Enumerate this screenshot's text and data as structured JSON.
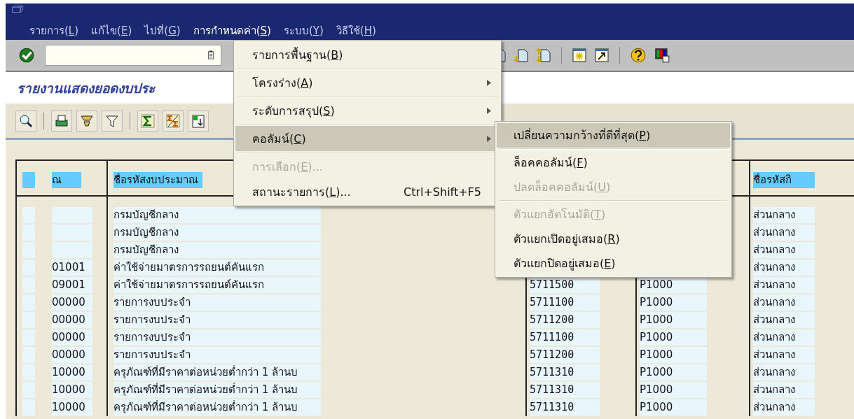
{
  "menu_bar": [
    {
      "label": "รายการ(L)",
      "selected": false
    },
    {
      "label": "แก้ไข(E)",
      "selected": false
    },
    {
      "label": "ไปที่(G)",
      "selected": false
    },
    {
      "label": "การกำหนดค่า(S)",
      "selected": true
    },
    {
      "label": "ระบบ(Y)",
      "selected": false
    },
    {
      "label": "วิธีใช้(H)",
      "selected": false
    }
  ],
  "report_title": "รายงานแสดงยอดงบประ",
  "table": {
    "header": {
      "column_1": "ณ",
      "column_2": "ชื่อรหัสงบประมาณ",
      "column_5": "ชื่อรหัสกิ"
    },
    "rows": [
      {
        "column_2": "กรมบัญชีกลาง",
        "column_5": "ส่วนกลาง"
      },
      {
        "column_2": "กรมบัญชีกลาง",
        "column_5": "ส่วนกลาง"
      },
      {
        "column_2": "กรมบัญชีกลาง",
        "column_5": "ส่วนกลาง"
      },
      {
        "column_1": "01001",
        "column_2": "ค่าใช้จ่ายมาตรการรถยนต์คันแรก",
        "column_5": "ส่วนกลาง"
      },
      {
        "column_1": "09001",
        "column_2": "ค่าใช้จ่ายมาตรการรถยนต์คันแรก",
        "column_3": "5711500",
        "column_4": "P1000",
        "column_5": "ส่วนกลาง"
      },
      {
        "column_1": "00000",
        "column_2": "รายการงบประจำ",
        "column_3": "5711100",
        "column_4": "P1000",
        "column_5": "ส่วนกลาง"
      },
      {
        "column_1": "00000",
        "column_2": "รายการงบประจำ",
        "column_3": "5711200",
        "column_4": "P1000",
        "column_5": "ส่วนกลาง"
      },
      {
        "column_1": "00000",
        "column_2": "รายการงบประจำ",
        "column_3": "5711100",
        "column_4": "P1000",
        "column_5": "ส่วนกลาง"
      },
      {
        "column_1": "00000",
        "column_2": "รายการงบประจำ",
        "column_3": "5711200",
        "column_4": "P1000",
        "column_5": "ส่วนกลาง"
      },
      {
        "column_1": "10000",
        "column_2": "ครุภัณฑ์ที่มีราคาต่อหน่วยต่ำกว่า 1 ล้านบ",
        "column_3": "5711310",
        "column_4": "P1000",
        "column_5": "ส่วนกลาง"
      },
      {
        "column_1": "10000",
        "column_2": "ครุภัณฑ์ที่มีราคาต่อหน่วยต่ำกว่า 1 ล้านบ",
        "column_3": "5711310",
        "column_4": "P1000",
        "column_5": "ส่วนกลาง"
      },
      {
        "column_1": "10000",
        "column_2": "ครุภัณฑ์ที่มีราคาต่อหน่วยต่ำกว่า 1 ล้านบ",
        "column_3": "5711310",
        "column_4": "P1000",
        "column_5": "ส่วนกลาง"
      }
    ]
  },
  "settings_menu": {
    "items": [
      {
        "kind": "item",
        "label": "รายการพื้นฐาน(B)",
        "submenu": false,
        "selected": false,
        "disabled": false
      },
      {
        "kind": "separator"
      },
      {
        "kind": "item",
        "label": "โครงร่าง(A)",
        "submenu": true,
        "selected": false,
        "disabled": false
      },
      {
        "kind": "separator"
      },
      {
        "kind": "item",
        "label": "ระดับการสรุป(S)",
        "submenu": true,
        "selected": false,
        "disabled": false
      },
      {
        "kind": "separator"
      },
      {
        "kind": "item",
        "label": "คอลัมน์(C)",
        "submenu": true,
        "selected": true,
        "disabled": false
      },
      {
        "kind": "separator"
      },
      {
        "kind": "item",
        "label": "การเลือก(E)...",
        "submenu": false,
        "selected": false,
        "disabled": true
      },
      {
        "kind": "item",
        "label": "สถานะรายการ(L)...",
        "shortcut": "Ctrl+Shift+F5",
        "submenu": false,
        "selected": false,
        "disabled": false
      }
    ]
  },
  "columns_submenu": {
    "items": [
      {
        "kind": "item",
        "label": "เปลี่ยนความกว้างที่ดีที่สุด(P)",
        "submenu": false,
        "selected": true,
        "disabled": false
      },
      {
        "kind": "separator"
      },
      {
        "kind": "item",
        "label": "ล็อคคอลัมน์(F)",
        "submenu": false,
        "selected": false,
        "disabled": false
      },
      {
        "kind": "item",
        "label": "ปลดล็อคคอลัมน์(U)",
        "submenu": false,
        "selected": false,
        "disabled": true
      },
      {
        "kind": "separator"
      },
      {
        "kind": "item",
        "label": "ตัวแยกอัตโนมัติ(T)",
        "submenu": false,
        "selected": false,
        "disabled": true
      },
      {
        "kind": "item",
        "label": "ตัวแยกเปิดอยู่เสมอ(R)",
        "submenu": false,
        "selected": false,
        "disabled": false
      },
      {
        "kind": "item",
        "label": "ตัวแยกปิดอยู่เสมอ(E)",
        "submenu": false,
        "selected": false,
        "disabled": false
      }
    ]
  }
}
